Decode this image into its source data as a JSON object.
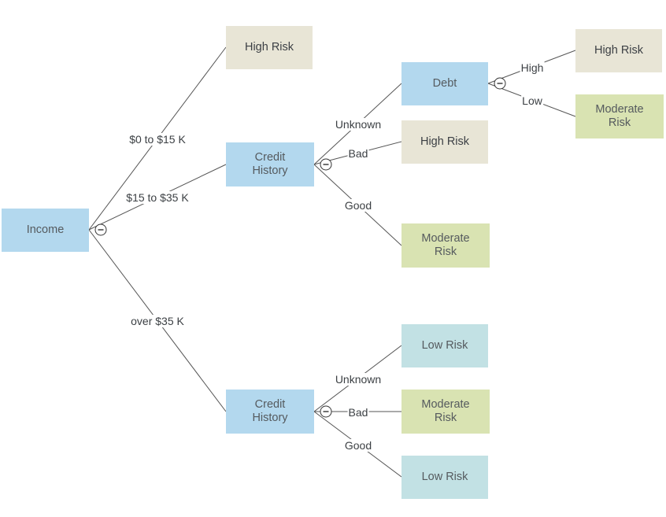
{
  "diagram": {
    "type": "decision-tree",
    "nodes": {
      "income": {
        "label": "Income",
        "kind": "decision"
      },
      "high_risk_1": {
        "label": "High Risk",
        "kind": "high"
      },
      "credit_history_1": {
        "label": "Credit\nHistory",
        "kind": "decision"
      },
      "credit_history_2": {
        "label": "Credit\nHistory",
        "kind": "decision"
      },
      "debt": {
        "label": "Debt",
        "kind": "decision"
      },
      "high_risk_2": {
        "label": "High Risk",
        "kind": "high"
      },
      "moderate_risk_1": {
        "label": "Moderate\nRisk",
        "kind": "moderate"
      },
      "high_risk_3": {
        "label": "High Risk",
        "kind": "high"
      },
      "moderate_risk_2": {
        "label": "Moderate\nRisk",
        "kind": "moderate"
      },
      "low_risk_1": {
        "label": "Low Risk",
        "kind": "low"
      },
      "moderate_risk_3": {
        "label": "Moderate\nRisk",
        "kind": "moderate"
      },
      "low_risk_2": {
        "label": "Low Risk",
        "kind": "low"
      }
    },
    "edges": {
      "income_low": {
        "from": "income",
        "to": "high_risk_1",
        "label": "$0 to $15 K"
      },
      "income_mid": {
        "from": "income",
        "to": "credit_history_1",
        "label": "$15 to $35 K"
      },
      "income_high": {
        "from": "income",
        "to": "credit_history_2",
        "label": "over $35 K"
      },
      "ch1_unknown": {
        "from": "credit_history_1",
        "to": "debt",
        "label": "Unknown"
      },
      "ch1_bad": {
        "from": "credit_history_1",
        "to": "high_risk_2",
        "label": "Bad"
      },
      "ch1_good": {
        "from": "credit_history_1",
        "to": "moderate_risk_1",
        "label": "Good"
      },
      "debt_high": {
        "from": "debt",
        "to": "high_risk_3",
        "label": "High"
      },
      "debt_low": {
        "from": "debt",
        "to": "moderate_risk_2",
        "label": "Low"
      },
      "ch2_unknown": {
        "from": "credit_history_2",
        "to": "low_risk_1",
        "label": "Unknown"
      },
      "ch2_bad": {
        "from": "credit_history_2",
        "to": "moderate_risk_3",
        "label": "Bad"
      },
      "ch2_good": {
        "from": "credit_history_2",
        "to": "low_risk_2",
        "label": "Good"
      }
    },
    "collapse_icon": "minus-circle-icon",
    "colors": {
      "decision": "#b3d8ee",
      "high_risk": "#e8e5d6",
      "moderate_risk": "#d9e3b2",
      "low_risk": "#c2e1e4",
      "connector": "#555555"
    }
  }
}
